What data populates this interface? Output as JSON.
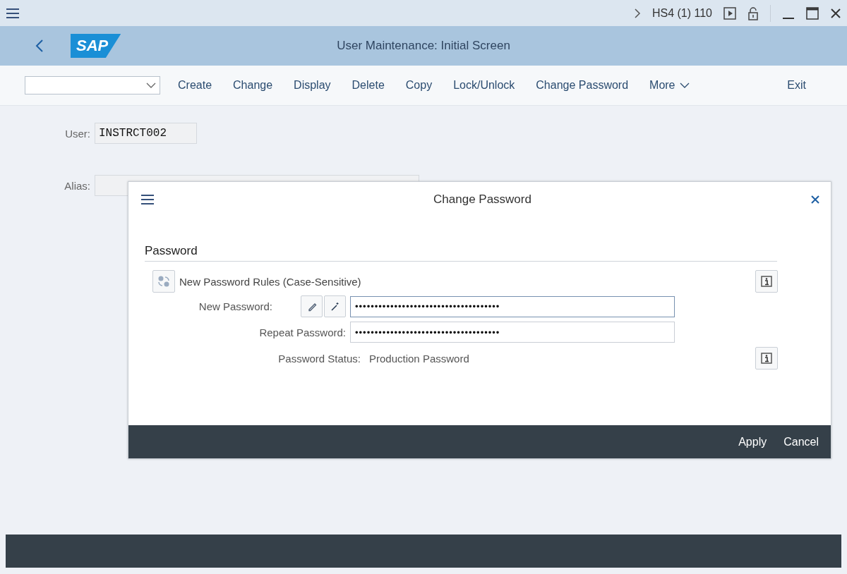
{
  "system_bar": {
    "system": "HS4 (1) 110"
  },
  "header": {
    "logo": "SAP",
    "title": "User Maintenance: Initial Screen"
  },
  "toolbar": {
    "buttons": [
      "Create",
      "Change",
      "Display",
      "Delete",
      "Copy",
      "Lock/Unlock",
      "Change Password",
      "More"
    ],
    "exit": "Exit"
  },
  "form": {
    "fields": [
      {
        "label": "User:",
        "value": "INSTRCT002"
      },
      {
        "label": "Alias:"
      }
    ]
  },
  "dialog": {
    "title": "Change Password",
    "section": "Password",
    "rules_label": "New Password Rules (Case-Sensitive)",
    "new_password": {
      "label": "New Password:",
      "value": "•••••••••••••••••••••••••••••••••••••"
    },
    "repeat_password": {
      "label": "Repeat Password:",
      "value": "•••••••••••••••••••••••••••••••••••••"
    },
    "status": {
      "label": "Password Status:",
      "value": "Production Password"
    },
    "buttons": [
      "Apply",
      "Cancel"
    ]
  }
}
